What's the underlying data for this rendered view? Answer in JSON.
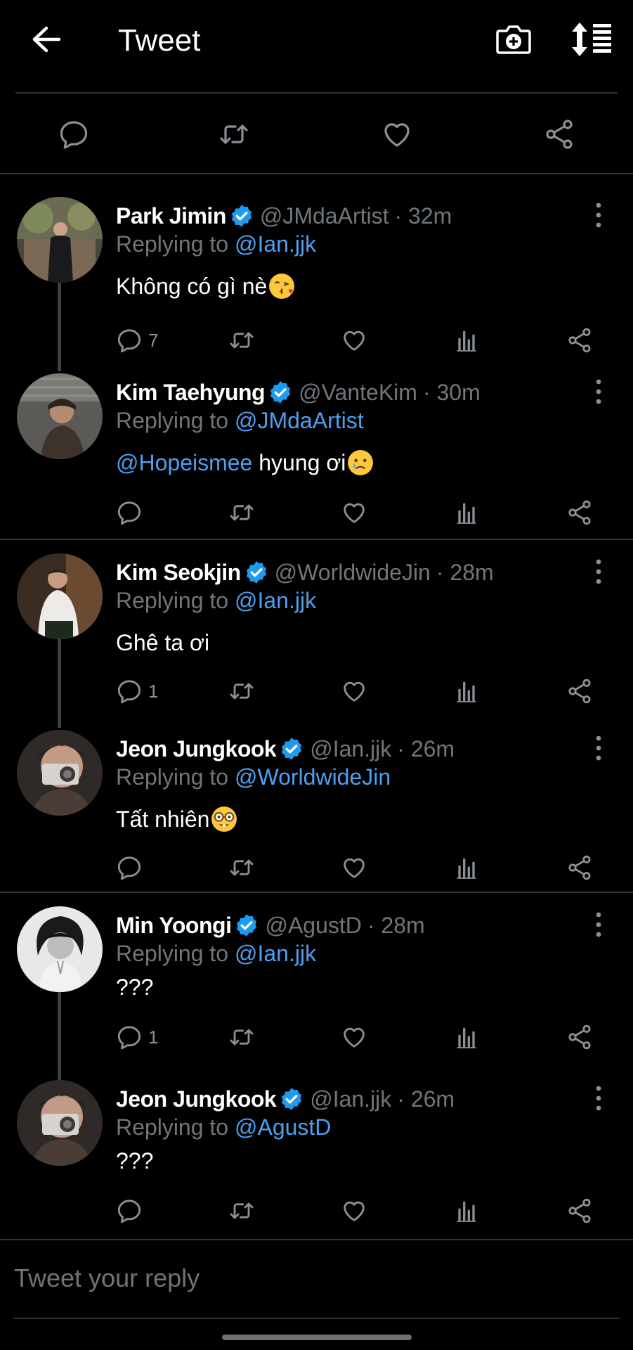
{
  "header": {
    "title": "Tweet",
    "icons": [
      "back-arrow-icon",
      "camera-add-icon",
      "sort-icon"
    ]
  },
  "main_actions": [
    "reply-icon",
    "retweet-icon",
    "like-icon",
    "share-icon"
  ],
  "replies": [
    {
      "name": "Park Jimin",
      "handle": "@JMdaArtist",
      "time": "· 32m",
      "replying_label": "Replying to ",
      "replying_to": "@Ian.jjk",
      "text": "Không có gì nè",
      "emoji": "kissing-face-emoji",
      "reply_count": "7"
    },
    {
      "name": "Kim Taehyung",
      "handle": "@VanteKim",
      "time": "· 30m",
      "replying_label": "Replying to ",
      "replying_to": "@JMdaArtist",
      "mention": "@Hopeismee",
      "text": " hyung ơi",
      "emoji": "crying-face-emoji",
      "reply_count": ""
    },
    {
      "name": "Kim Seokjin",
      "handle": "@WorldwideJin",
      "time": "· 28m",
      "replying_label": "Replying to ",
      "replying_to": "@Ian.jjk",
      "text": "Ghê ta ơi",
      "reply_count": "1"
    },
    {
      "name": "Jeon Jungkook",
      "handle": "@Ian.jjk",
      "time": "· 26m",
      "replying_label": "Replying to ",
      "replying_to": "@WorldwideJin",
      "text": "Tất nhiên",
      "emoji": "nerd-face-emoji",
      "reply_count": ""
    },
    {
      "name": "Min Yoongi",
      "handle": "@AgustD",
      "time": "· 28m",
      "replying_label": "Replying to ",
      "replying_to": "@Ian.jjk",
      "text": "???",
      "reply_count": "1"
    },
    {
      "name": "Jeon Jungkook",
      "handle": "@Ian.jjk",
      "time": "· 26m",
      "replying_label": "Replying to ",
      "replying_to": "@AgustD",
      "text": "???",
      "reply_count": ""
    }
  ],
  "composer": {
    "placeholder": "Tweet your reply"
  },
  "colors": {
    "background": "#000000",
    "link": "#4e9ff0",
    "secondary_text": "#71767b",
    "verified": "#1d9bf0",
    "divider": "#2f3336"
  }
}
